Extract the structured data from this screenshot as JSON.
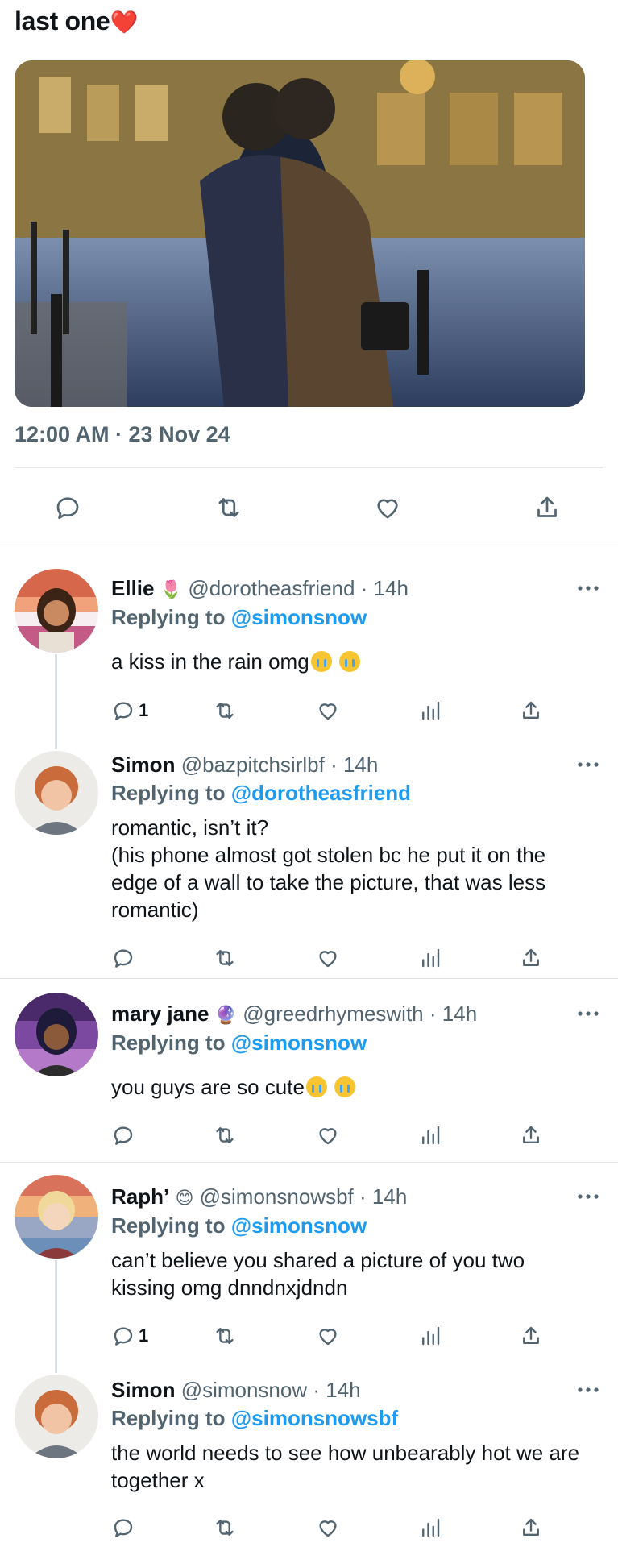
{
  "post": {
    "headline": "last one",
    "heart_emoji": "❤️",
    "timestamp": "12:00 AM · 23 Nov 24"
  },
  "colors": {
    "accent": "#1d9bf0",
    "muted": "#536471",
    "text": "#0f1419",
    "divider": "#e1e6ea"
  },
  "icons": [
    "reply-icon",
    "retweet-icon",
    "like-icon",
    "views-icon",
    "share-icon",
    "more-icon"
  ],
  "replies": [
    {
      "display_name": "Ellie",
      "name_emoji": "🌷",
      "handle": "@dorotheasfriend",
      "time": "· 14h",
      "replying_prefix": "Replying to",
      "replying_to": "@simonsnow",
      "text": "a kiss in the rain omg",
      "reply_count": "1"
    },
    {
      "display_name": "Simon",
      "handle": "@bazpitchsirlbf",
      "time": "· 14h",
      "replying_prefix": "Replying to",
      "replying_to": "@dorotheasfriend",
      "text": "romantic, isn’t it?\n(his phone almost got stolen bc he put it on the edge of a wall to take the picture, that was less romantic)",
      "reply_count": ""
    },
    {
      "display_name": "mary jane",
      "name_emoji": "🔮",
      "handle": "@greedrhymeswith",
      "time": "· 14h",
      "replying_prefix": "Replying to",
      "replying_to": "@simonsnow",
      "text": "you guys are so cute",
      "reply_count": ""
    },
    {
      "display_name": "Raph’",
      "name_emoji": "😊",
      "handle": "@simonsnowsbf",
      "time": "· 14h",
      "replying_prefix": "Replying to",
      "replying_to": "@simonsnow",
      "text": "can’t believe you shared a picture of you two kissing omg dnndnxjdndn",
      "reply_count": "1"
    },
    {
      "display_name": "Simon",
      "handle": "@simonsnow",
      "time": "· 14h",
      "replying_prefix": "Replying to",
      "replying_to": "@simonsnowsbf",
      "text": "the world needs to see how unbearably hot we are together x",
      "reply_count": ""
    }
  ]
}
